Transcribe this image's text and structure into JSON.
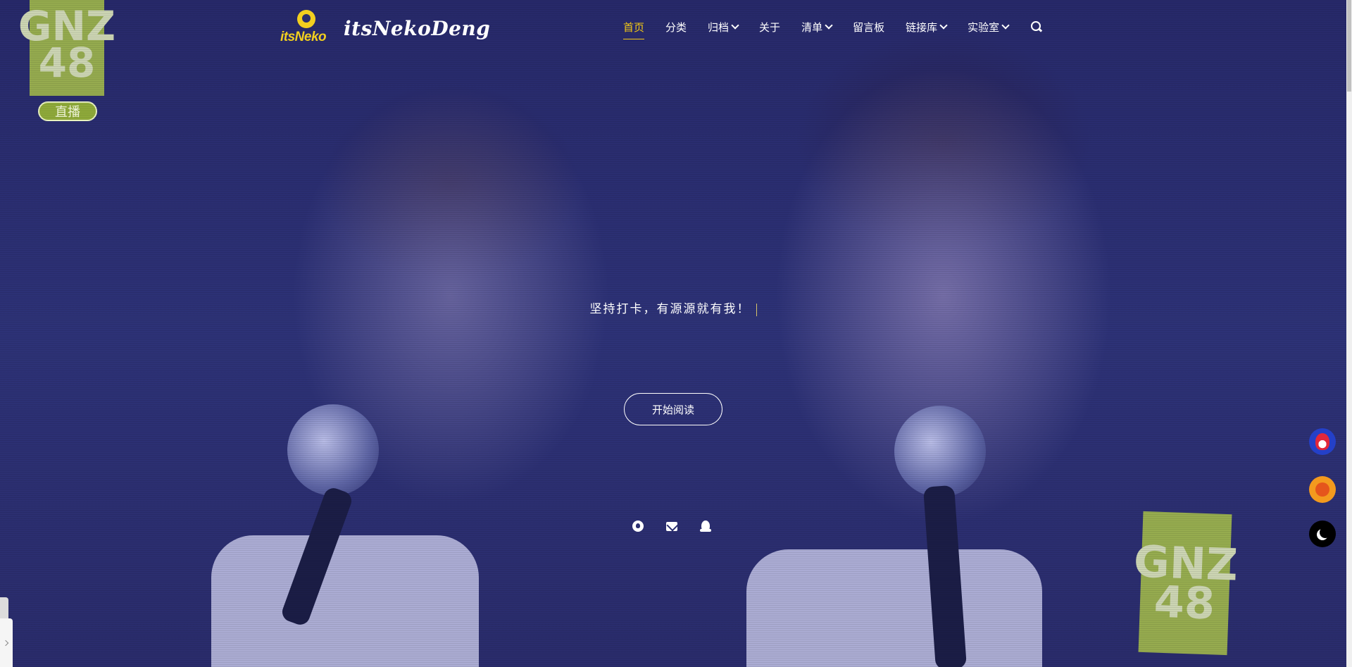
{
  "brand": {
    "mark_text": "itsNeko",
    "title": "itsNekoDeng"
  },
  "nav": {
    "items": [
      {
        "label": "首页",
        "active": true,
        "dropdown": false
      },
      {
        "label": "分类",
        "active": false,
        "dropdown": false
      },
      {
        "label": "归档",
        "active": false,
        "dropdown": true
      },
      {
        "label": "关于",
        "active": false,
        "dropdown": false
      },
      {
        "label": "清单",
        "active": false,
        "dropdown": true
      },
      {
        "label": "留言板",
        "active": false,
        "dropdown": false
      },
      {
        "label": "链接库",
        "active": false,
        "dropdown": true
      },
      {
        "label": "实验室",
        "active": false,
        "dropdown": true
      }
    ],
    "search_icon": "search-icon"
  },
  "hero": {
    "tagline": "坚持打卡，有源源就有我！",
    "start_button": "开始阅读",
    "background_badge_top": "GNZ\n48",
    "background_badge_live": "直播",
    "background_badge_bottom": "GNZ\n48"
  },
  "social": [
    {
      "name": "github",
      "icon": "github-icon"
    },
    {
      "name": "email",
      "icon": "mail-icon"
    },
    {
      "name": "qq",
      "icon": "qq-icon"
    }
  ],
  "floating": [
    {
      "name": "santa",
      "icon": "santa-icon"
    },
    {
      "name": "decoration",
      "icon": "orange-icon"
    },
    {
      "name": "dark-mode",
      "icon": "moon-icon"
    }
  ],
  "colors": {
    "accent": "#f3c814",
    "background": "#2a2e6e",
    "text": "#ffffff"
  }
}
